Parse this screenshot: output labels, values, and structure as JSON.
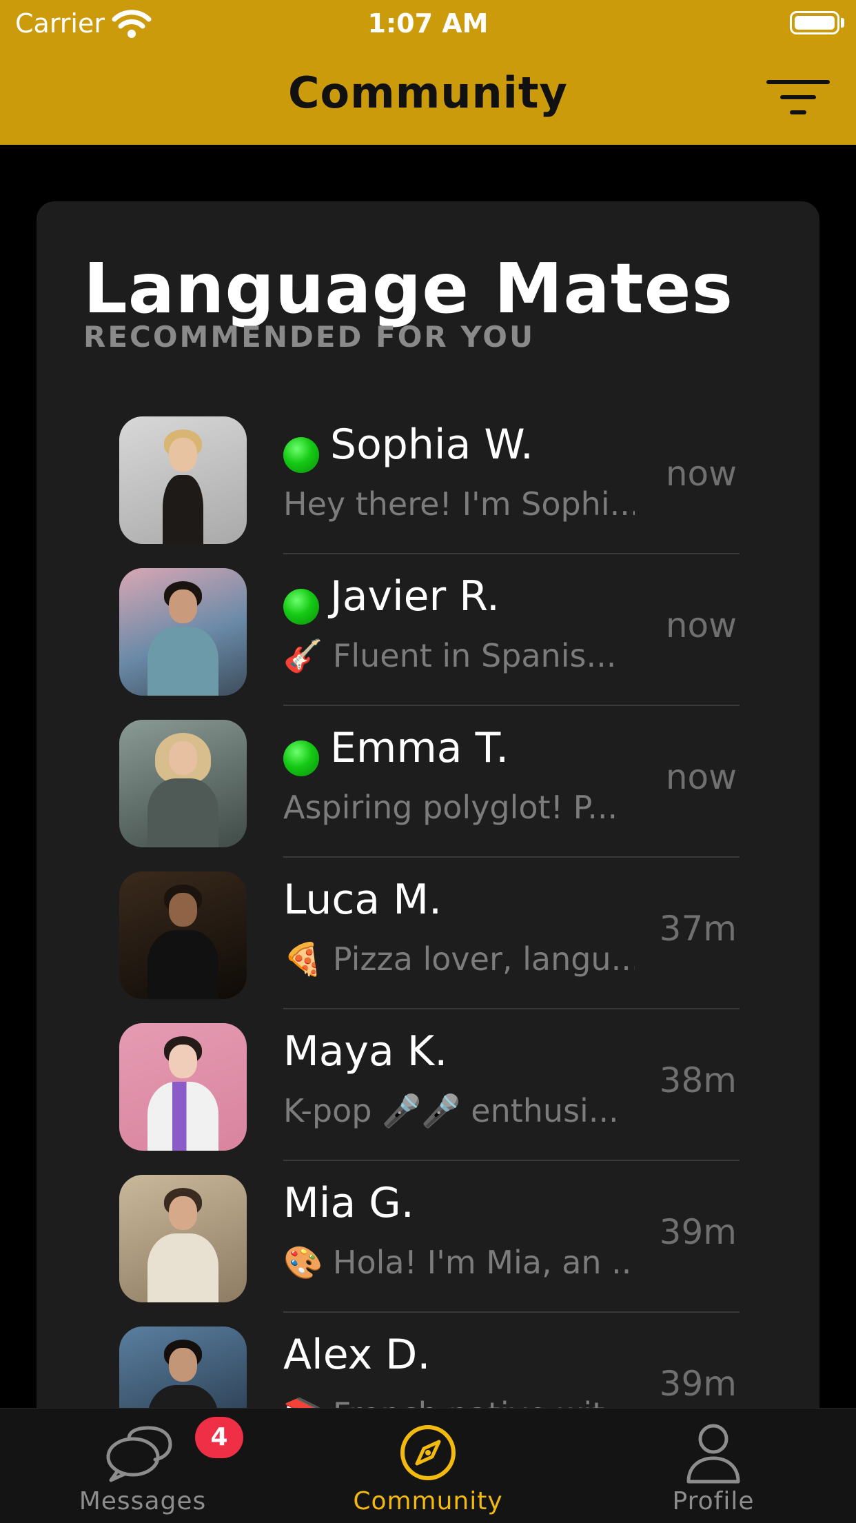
{
  "status_bar": {
    "carrier": "Carrier",
    "time": "1:07 AM"
  },
  "header": {
    "title": "Community"
  },
  "section": {
    "title": "Language Mates",
    "subtitle": "RECOMMENDED FOR YOU"
  },
  "mates": [
    {
      "name": "Sophia W.",
      "online": true,
      "preview": "Hey there! I'm Sophi...",
      "time": "now"
    },
    {
      "name": "Javier R.",
      "online": true,
      "preview": "🎸 Fluent in Spanis...",
      "time": "now"
    },
    {
      "name": "Emma T.",
      "online": true,
      "preview": "Aspiring polyglot! P...",
      "time": "now"
    },
    {
      "name": "Luca M.",
      "online": false,
      "preview": "🍕 Pizza lover, langu...",
      "time": "37m"
    },
    {
      "name": "Maya K.",
      "online": false,
      "preview": "K-pop 🎤🎤 enthusi...",
      "time": "38m"
    },
    {
      "name": "Mia G.",
      "online": false,
      "preview": "🎨 Hola! I'm Mia, an ...",
      "time": "39m"
    },
    {
      "name": "Alex D.",
      "online": false,
      "preview": "📚 French native wit...",
      "time": "39m"
    }
  ],
  "tabs": [
    {
      "label": "Messages",
      "icon": "chat-bubbles-icon",
      "badge": "4",
      "active": false
    },
    {
      "label": "Community",
      "icon": "compass-icon",
      "active": true
    },
    {
      "label": "Profile",
      "icon": "person-icon",
      "active": false
    }
  ],
  "colors": {
    "accent": "#cc9b0c",
    "active_tab": "#f2b90f",
    "online": "#15c915",
    "badge": "#ef2f45"
  }
}
